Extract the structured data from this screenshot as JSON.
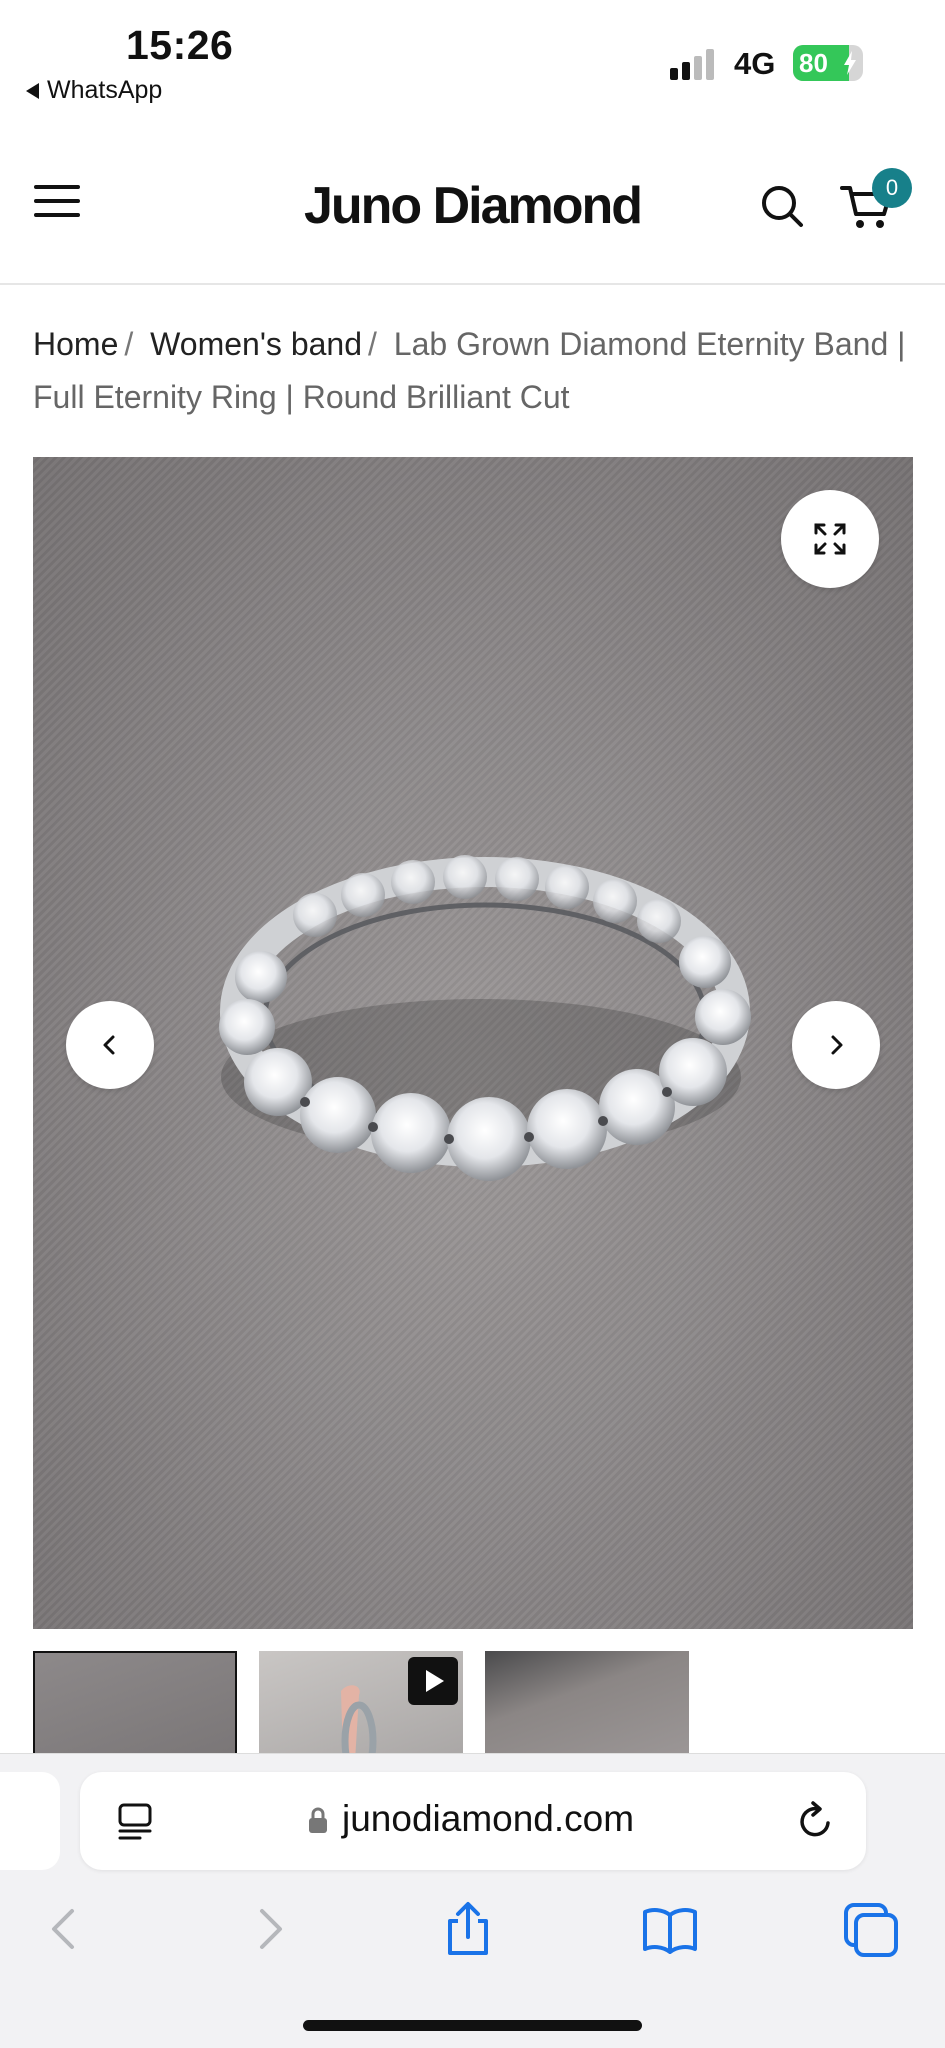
{
  "status_bar": {
    "time": "15:26",
    "back_app": "WhatsApp",
    "network": "4G",
    "battery_level": "80",
    "battery_fraction": 0.8
  },
  "header": {
    "logo": "Juno Diamond",
    "cart_count": "0",
    "accent_color": "#17808a"
  },
  "breadcrumb": {
    "items": [
      "Home",
      "Women's band"
    ],
    "separator": "/",
    "current": "Lab Grown Diamond Eternity Band | Full Eternity Ring | Round Brilliant Cut"
  },
  "gallery": {
    "main_image": "diamond eternity ring on grey velvet",
    "thumbnails": [
      "ring-photo",
      "ring-video",
      "ring-photo-2"
    ],
    "active_thumbnail": 0
  },
  "browser": {
    "url": "junodiamond.com"
  }
}
